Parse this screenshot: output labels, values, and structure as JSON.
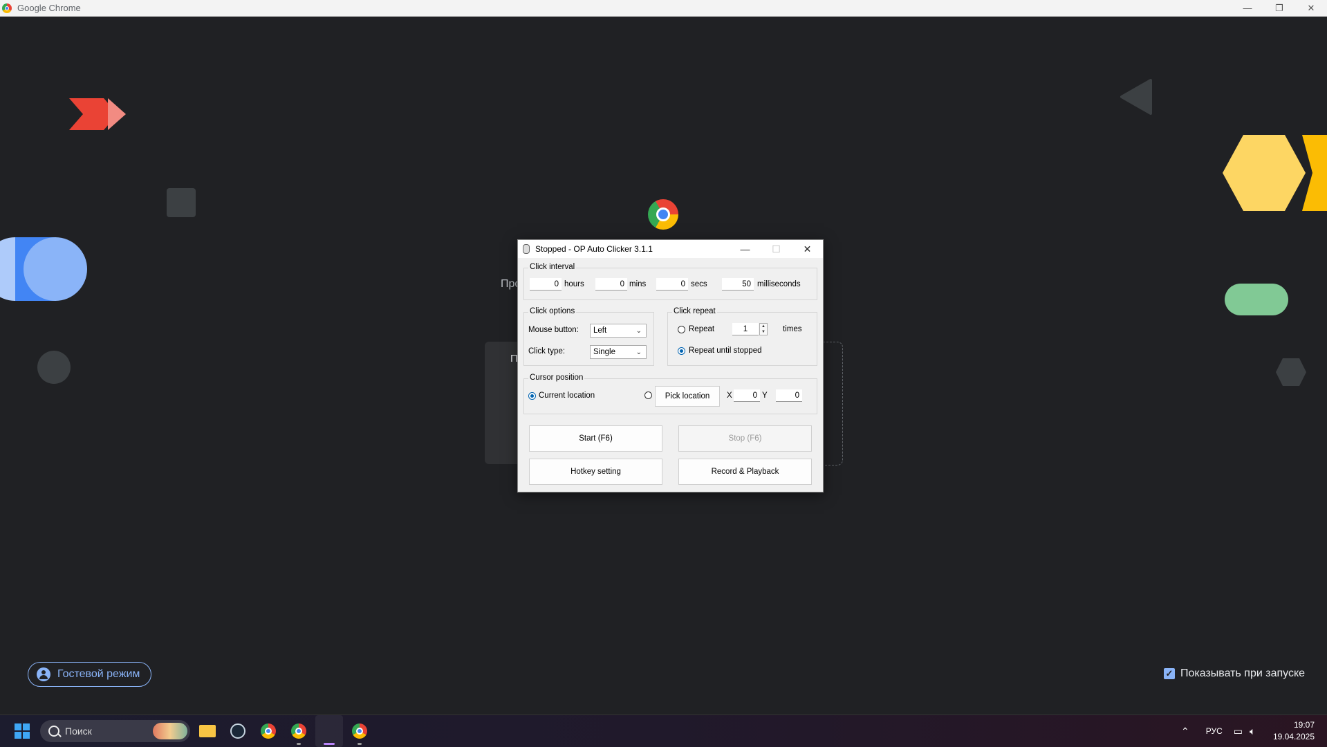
{
  "chrome_window": {
    "title": "Google Chrome",
    "profile_text_left": "Про",
    "profile_text_right": ",",
    "profile_card_letter": "П",
    "guest_button": "Гостевой режим",
    "show_on_startup": "Показывать при запуске",
    "show_on_startup_checked": true,
    "controls": {
      "minimize": "—",
      "restore": "❐",
      "close": "✕"
    }
  },
  "autoclicker": {
    "title": "Stopped - OP Auto Clicker 3.1.1",
    "controls": {
      "minimize": "—",
      "maximize": "☐",
      "close": "✕"
    },
    "click_interval": {
      "label": "Click interval",
      "hours_value": "0",
      "hours_label": "hours",
      "mins_value": "0",
      "mins_label": "mins",
      "secs_value": "0",
      "secs_label": "secs",
      "ms_value": "50",
      "ms_label": "milliseconds"
    },
    "click_options": {
      "label": "Click options",
      "mouse_button_label": "Mouse button:",
      "mouse_button_value": "Left",
      "click_type_label": "Click type:",
      "click_type_value": "Single"
    },
    "click_repeat": {
      "label": "Click repeat",
      "repeat_label": "Repeat",
      "repeat_value": "1",
      "times_label": "times",
      "repeat_until_stopped_label": "Repeat until stopped",
      "selected": "repeat_until_stopped"
    },
    "cursor_position": {
      "label": "Cursor position",
      "current_location_label": "Current location",
      "pick_location_label": "Pick location",
      "x_label": "X",
      "x_value": "0",
      "y_label": "Y",
      "y_value": "0",
      "selected": "current_location"
    },
    "buttons": {
      "start": "Start (F6)",
      "stop": "Stop (F6)",
      "hotkey": "Hotkey setting",
      "record": "Record & Playback"
    }
  },
  "taskbar": {
    "search_placeholder": "Поиск",
    "language": "РУС",
    "time": "19:07",
    "date": "19.04.2025"
  },
  "colors": {
    "page_bg": "#202124",
    "accent_blue": "#8ab4f8",
    "radio_selected": "#0063b1"
  }
}
